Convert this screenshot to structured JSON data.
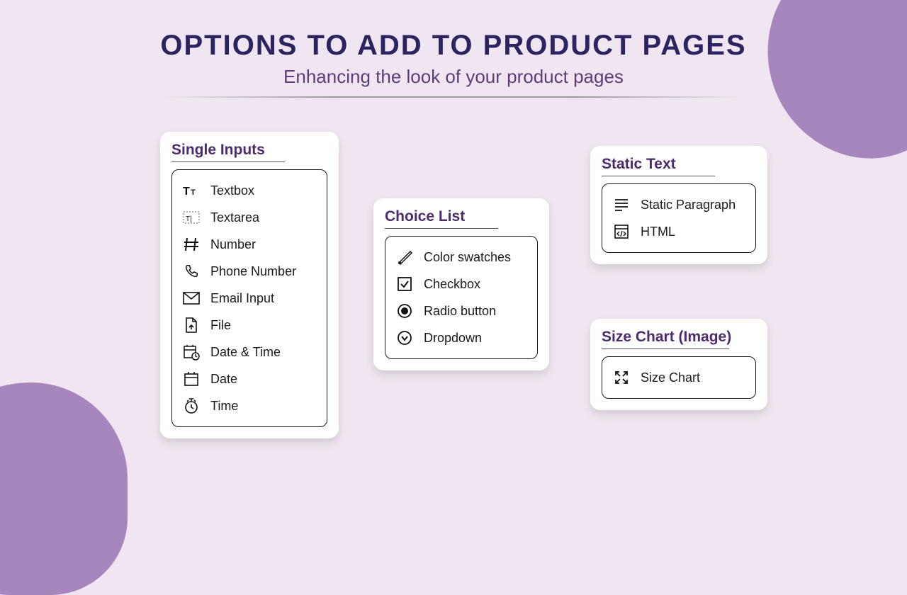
{
  "header": {
    "title": "OPTIONS TO ADD TO PRODUCT PAGES",
    "subtitle": "Enhancing the look of your product pages"
  },
  "cards": {
    "single": {
      "title": "Single Inputs",
      "items": [
        "Textbox",
        "Textarea",
        "Number",
        "Phone Number",
        "Email Input",
        "File",
        "Date & Time",
        "Date",
        "Time"
      ]
    },
    "choice": {
      "title": "Choice List",
      "items": [
        "Color swatches",
        "Checkbox",
        "Radio button",
        "Dropdown"
      ]
    },
    "static": {
      "title": "Static Text",
      "items": [
        "Static Paragraph",
        "HTML"
      ]
    },
    "size": {
      "title": "Size Chart (Image)",
      "items": [
        "Size Chart"
      ]
    }
  }
}
